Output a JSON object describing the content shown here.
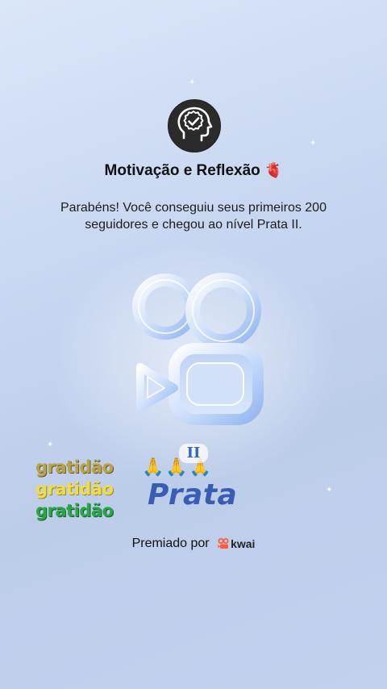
{
  "badge": {
    "title": "Motivação e Reflexão",
    "title_emoji": "🫀",
    "message": "Parabéns! Você conseguiu seus primeiros 200 seguidores e chegou ao nível Prata II.",
    "gratitude_words": [
      "gratidão",
      "gratidão",
      "gratidão"
    ],
    "prayer_emojis": "🙏🙏🙏",
    "level_badge": "II",
    "level_name": "Prata",
    "awarded_by": "Premiado por",
    "brand": "kwai"
  },
  "colors": {
    "background_top": "#dbe6f9",
    "background_bottom": "#c3d1ef",
    "level_color": "#3a5db4",
    "gratitude_colors": [
      "#b9a34c",
      "#f0dc4a",
      "#2ea54a"
    ],
    "brand_color": "#ff5b3a"
  },
  "icons": [
    "head-checkmark-icon",
    "heart-icon",
    "kwai-logo-icon",
    "prayer-hands-icon"
  ]
}
